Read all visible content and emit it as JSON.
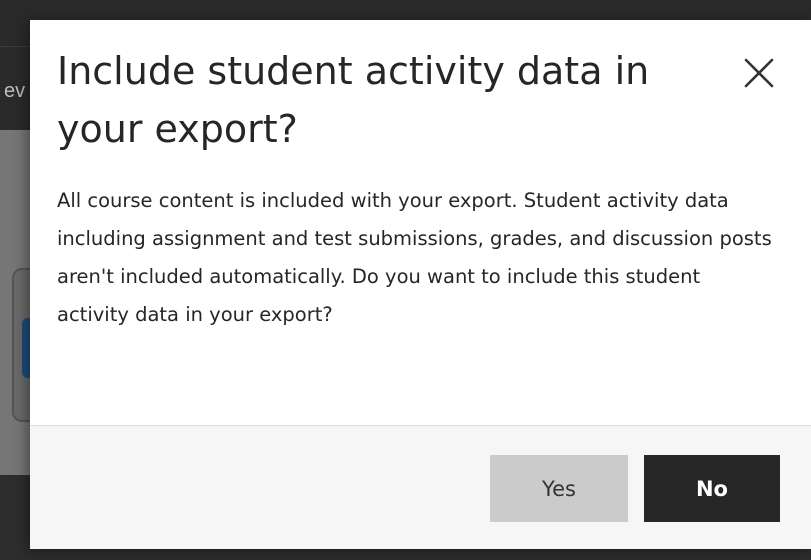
{
  "background": {
    "fragment_text": "ev"
  },
  "dialog": {
    "title": "Include student activity data in your export?",
    "message": "All course content is included with your export. Student activity data including assignment and test submissions, grades, and discussion posts aren't included automatically. Do you want to include this student activity data in your export?",
    "close_icon": "close-icon",
    "buttons": {
      "yes_label": "Yes",
      "no_label": "No"
    }
  },
  "colors": {
    "primary_button": "#262626",
    "secondary_button": "#cbcbcb",
    "text": "#262626",
    "overlay": "#6e6e6e"
  }
}
